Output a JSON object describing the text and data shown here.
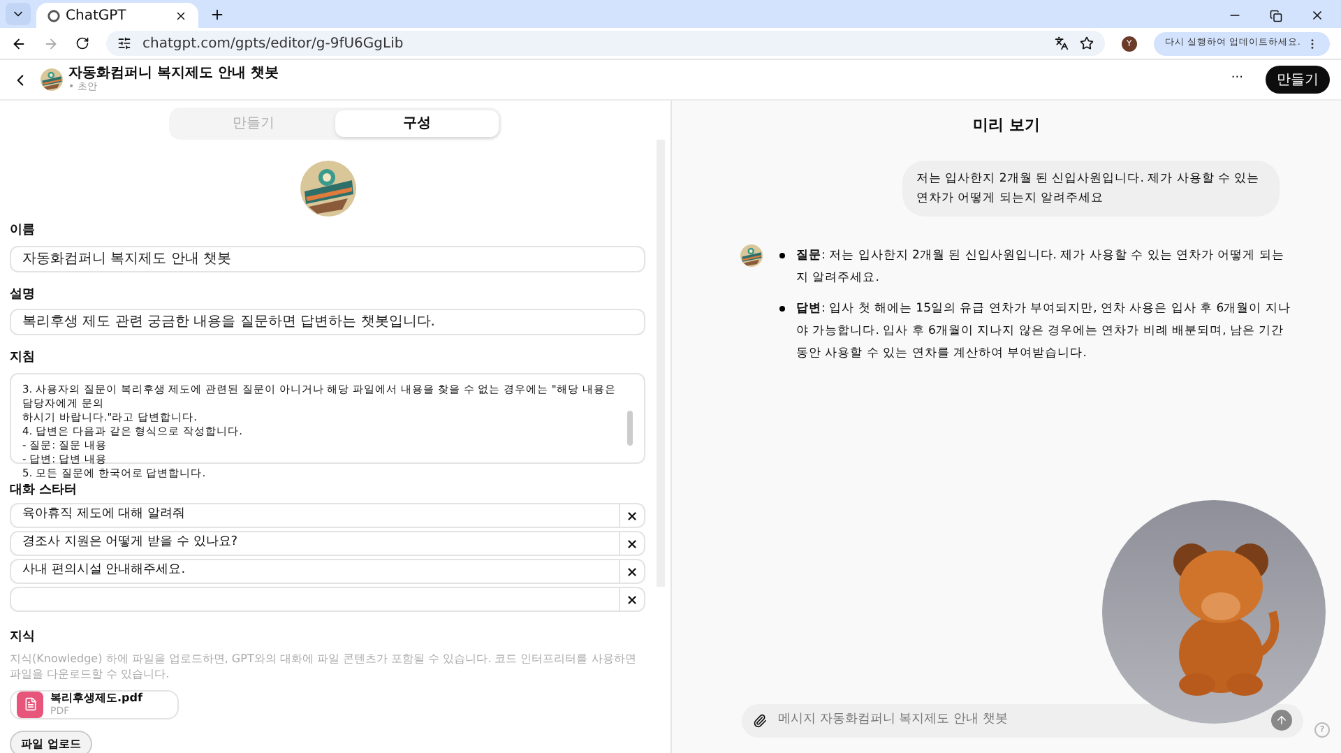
{
  "browser": {
    "tab_title": "ChatGPT",
    "url": "chatgpt.com/gpts/editor/g-9fU6GgLib",
    "profile_initial": "Y",
    "update_button": "다시 실행하여 업데이트하세요."
  },
  "header": {
    "title": "자동화컴퍼니 복지제도 안내 챗봇",
    "subtitle": "• 초안",
    "more": "···",
    "create_button": "만들기"
  },
  "tabs": [
    {
      "label": "만들기",
      "selected": false
    },
    {
      "label": "구성",
      "selected": true
    }
  ],
  "form": {
    "name_label": "이름",
    "name_value": "자동화컴퍼니 복지제도 안내 챗봇",
    "description_label": "설명",
    "description_value": "복리후생 제도 관련 궁금한 내용을 질문하면 답변하는 챗봇입니다.",
    "instructions_label": "지침",
    "instructions_lines": [
      "3. 사용자의 질문이 복리후생 제도에 관련된 질문이 아니거나 해당 파일에서 내용을 찾을 수 없는 경우에는 \"해당 내용은 담당자에게 문의",
      "하시기 바랍니다.\"라고 답변합니다.",
      "4. 답변은 다음과 같은 형식으로 작성합니다.",
      "- 질문: 질문 내용",
      "- 답변: 답변 내용",
      "5. 모든 질문에 한국어로 답변합니다."
    ],
    "starters_label": "대화 스타터",
    "starters": [
      "육아휴직 제도에 대해 알려줘",
      "경조사 지원은 어떻게 받을 수 있나요?",
      "사내 편의시설 안내해주세요."
    ],
    "knowledge_label": "지식",
    "knowledge_hint": "지식(Knowledge) 하에 파일을 업로드하면, GPT와의 대화에 파일 콘텐츠가 포함될 수 있습니다. 코드 인터프리터를 사용하면 파일을 다운로드할 수 있습니다.",
    "file": {
      "name": "복리후생제도.pdf",
      "type": "PDF"
    },
    "upload_button": "파일 업로드"
  },
  "preview": {
    "title": "미리 보기",
    "user_message": "저는 입사한지 2개월 된 신입사원입니다. 제가 사용할 수 있는 연차가 어떻게 되는지 알려주세요",
    "bot_items": [
      "**질문**: 저는 입사한지 2개월 된 신입사원입니다. 제가 사용할 수 있는 연차가 어떻게 되는지 알려주세요.",
      "**답변**: 입사 첫 해에는 15일의 유급 연차가 부여되지만, 연차 사용은 입사 후 6개월이 지나야 가능합니다. 입사 후 6개월이 지나지 않은 경우에는 연차가 비례 배분되며, 남은 기간 동안 사용할 수 있는 연차를 계산하여 부여받습니다."
    ],
    "composer_placeholder": "메시지 자동화컴퍼니 복지제도 안내 챗봇",
    "help": "?"
  }
}
